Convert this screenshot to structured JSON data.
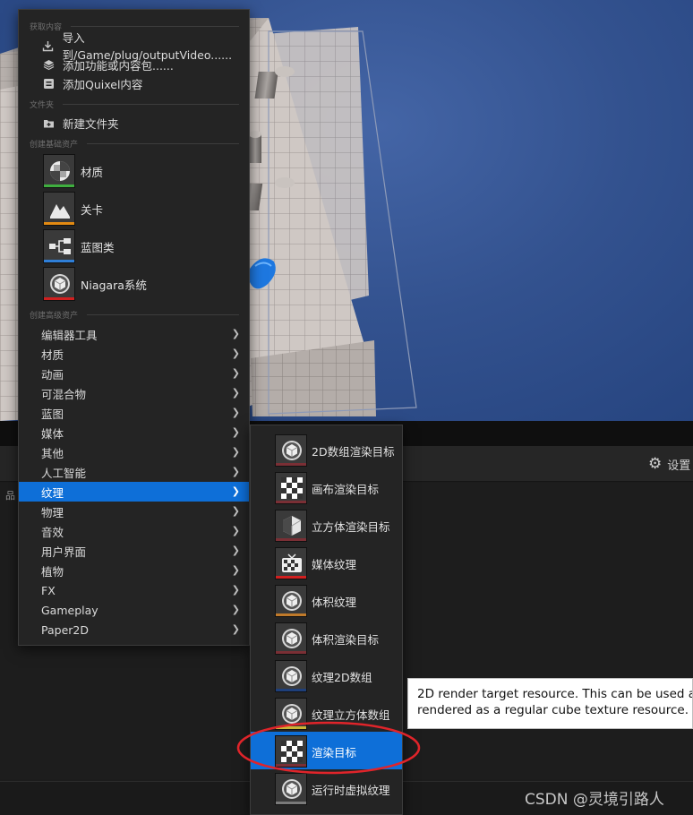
{
  "settings": {
    "label": "设置"
  },
  "left_sliver": {
    "text": "品"
  },
  "menu": {
    "section_get_content": "获取内容",
    "import_label": "导入到/Game/plug/outputVideo......",
    "add_feature_label": "添加功能或内容包......",
    "add_quixel_label": "添加Quixel内容",
    "section_folder": "文件夹",
    "new_folder_label": "新建文件夹",
    "section_basic": "创建基础资产",
    "basic_assets": [
      {
        "label": "材质",
        "icon": "material-sphere-icon",
        "color": "#3fae3f"
      },
      {
        "label": "关卡",
        "icon": "level-mountain-icon",
        "color": "#e38a12"
      },
      {
        "label": "蓝图类",
        "icon": "blueprint-graph-icon",
        "color": "#2f7fd8"
      },
      {
        "label": "Niagara系统",
        "icon": "niagara-cube-icon",
        "color": "#d11f1f"
      }
    ],
    "section_advanced": "创建高级资产",
    "categories": [
      {
        "label": "编辑器工具"
      },
      {
        "label": "材质"
      },
      {
        "label": "动画"
      },
      {
        "label": "可混合物"
      },
      {
        "label": "蓝图"
      },
      {
        "label": "媒体"
      },
      {
        "label": "其他"
      },
      {
        "label": "人工智能"
      },
      {
        "label": "纹理",
        "selected": true
      },
      {
        "label": "物理"
      },
      {
        "label": "音效"
      },
      {
        "label": "用户界面"
      },
      {
        "label": "植物"
      },
      {
        "label": "FX"
      },
      {
        "label": "Gameplay"
      },
      {
        "label": "Paper2D"
      }
    ]
  },
  "submenu": {
    "items": [
      {
        "label": "2D数组渲染目标",
        "icon": "cube-icon",
        "color": "#7a2f35"
      },
      {
        "label": "画布渲染目标",
        "icon": "checker-icon",
        "color": "#7a2f35"
      },
      {
        "label": "立方体渲染目标",
        "icon": "half-cube-icon",
        "color": "#7a2f35"
      },
      {
        "label": "媒体纹理",
        "icon": "tv-icon",
        "color": "#d11f1f"
      },
      {
        "label": "体积纹理",
        "icon": "cube-icon",
        "color": "#c07a2a"
      },
      {
        "label": "体积渲染目标",
        "icon": "cube-icon",
        "color": "#7a2f35"
      },
      {
        "label": "纹理2D数组",
        "icon": "cube-icon",
        "color": "#1e3f7a"
      },
      {
        "label": "纹理立方体数组",
        "icon": "cube-icon",
        "color": "#c9b436"
      },
      {
        "label": "渲染目标",
        "icon": "checker-icon",
        "color": "#7a2f35",
        "selected": true
      },
      {
        "label": "运行时虚拟纹理",
        "icon": "cube-icon",
        "color": "#7a7a7a"
      }
    ]
  },
  "tooltip": {
    "line1": "2D render target resource.  This can be used a",
    "line2": "rendered as a regular cube texture resource."
  },
  "watermark": {
    "text": "CSDN @灵境引路人"
  }
}
